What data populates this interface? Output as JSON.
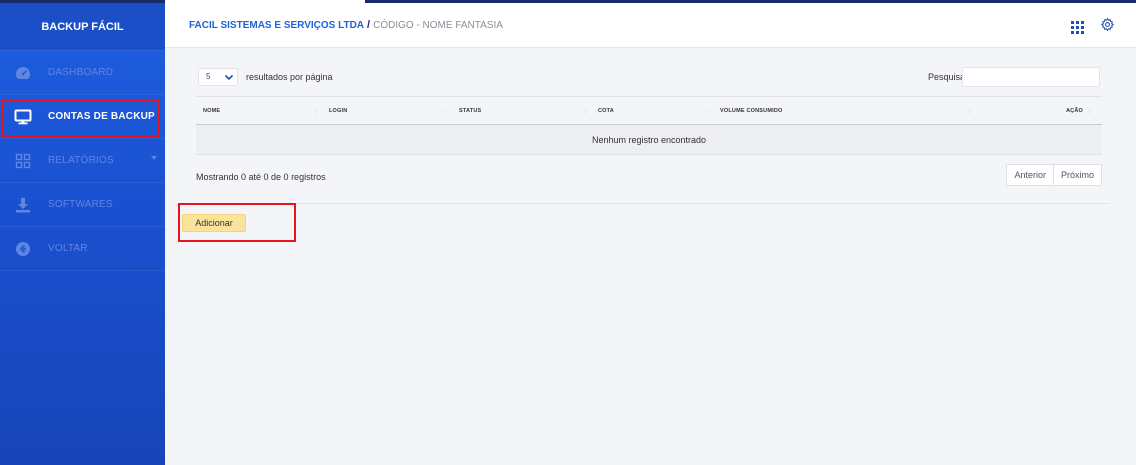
{
  "app": {
    "brand": "BACKUP FÁCIL"
  },
  "colors": {
    "sidebar": "#1d5fe0",
    "accent": "#1e63d6",
    "highlight_box": "#e8141c",
    "add_button": "#fbe39a"
  },
  "sidebar": {
    "items": [
      {
        "label": "DASHBOARD",
        "icon": "speedometer-icon",
        "active": false
      },
      {
        "label": "CONTAS DE BACKUP",
        "icon": "monitor-icon",
        "active": true
      },
      {
        "label": "RELATÓRIOS",
        "icon": "grid-squares-icon",
        "active": false,
        "has_submenu": true
      },
      {
        "label": "SOFTWARES",
        "icon": "download-icon",
        "active": false
      },
      {
        "label": "VOLTAR",
        "icon": "arrow-left-circle-icon",
        "active": false
      }
    ]
  },
  "header": {
    "company": "FACIL SISTEMAS E SERVIÇOS LTDA",
    "separator": "/",
    "code_name": "CÓDIGO - NOME FANTASIA",
    "icons": [
      "apps-grid-icon",
      "settings-gear-icon"
    ]
  },
  "table_controls": {
    "page_length": "5",
    "page_length_label": "resultados por página",
    "search_label": "Pesquisar",
    "search_value": ""
  },
  "table": {
    "columns": [
      "NOME",
      "LOGIN",
      "STATUS",
      "COTA",
      "VOLUME CONSUMIDO",
      "AÇÃO"
    ],
    "empty_message": "Nenhum registro encontrado"
  },
  "footer": {
    "info": "Mostrando 0 até 0 de 0 registros",
    "prev": "Anterior",
    "next": "Próximo"
  },
  "actions": {
    "add_label": "Adicionar"
  }
}
